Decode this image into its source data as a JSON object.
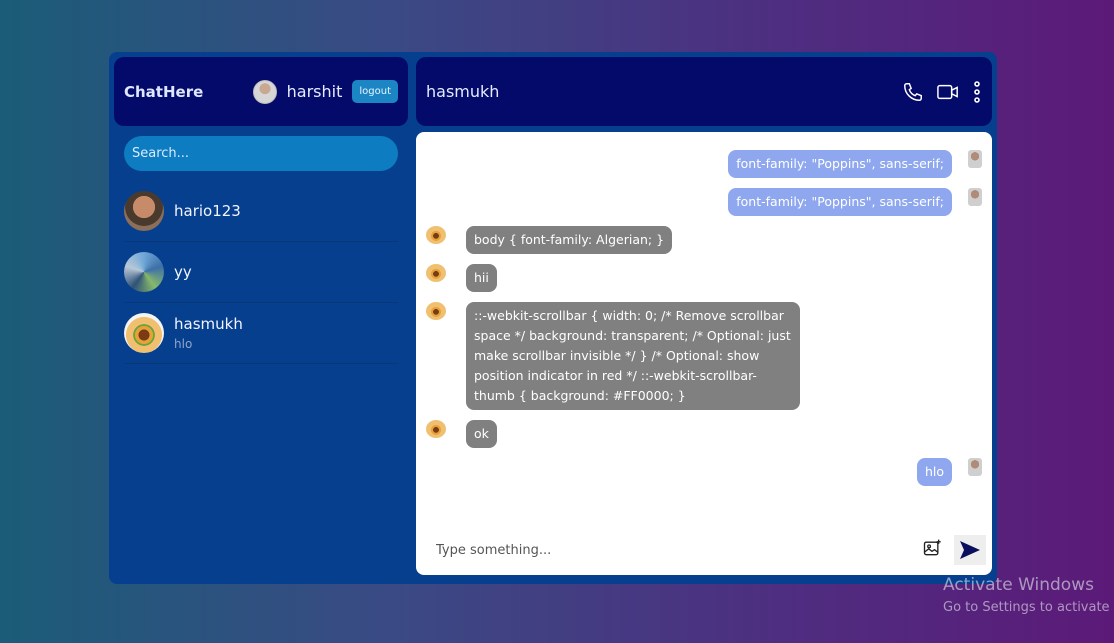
{
  "sidebar": {
    "logo": "ChatHere",
    "user_name": "harshit",
    "logout_label": "logout",
    "search_placeholder": "Search...",
    "contacts": [
      {
        "name": "hario123",
        "last": ""
      },
      {
        "name": "yy",
        "last": ""
      },
      {
        "name": "hasmukh",
        "last": "hlo"
      }
    ]
  },
  "chat": {
    "title": "hasmukh",
    "actions": [
      "phone-icon",
      "video-icon",
      "more-vertical-icon"
    ],
    "messages": [
      {
        "dir": "out",
        "text": "font-family: \"Poppins\", sans-serif;"
      },
      {
        "dir": "out",
        "text": "font-family: \"Poppins\", sans-serif;"
      },
      {
        "dir": "in",
        "text": "body { font-family: Algerian; }"
      },
      {
        "dir": "in",
        "text": "hii"
      },
      {
        "dir": "in",
        "text": "::-webkit-scrollbar { width: 0; /* Remove scrollbar space */ background: transparent; /* Optional: just make scrollbar invisible */ } /* Optional: show position indicator in red */ ::-webkit-scrollbar-thumb { background: #FF0000; }"
      },
      {
        "dir": "in",
        "text": "ok"
      },
      {
        "dir": "out",
        "text": "hlo"
      }
    ],
    "input_placeholder": "Type something..."
  },
  "watermark": {
    "line1": "Activate Windows",
    "line2": "Go to Settings to activate"
  },
  "colors": {
    "app_bg": "#053f8e",
    "header_bg": "#030a6a",
    "search_bg": "#0e7cc1",
    "out_bubble": "#8ea7ee",
    "in_bubble": "#808080"
  }
}
